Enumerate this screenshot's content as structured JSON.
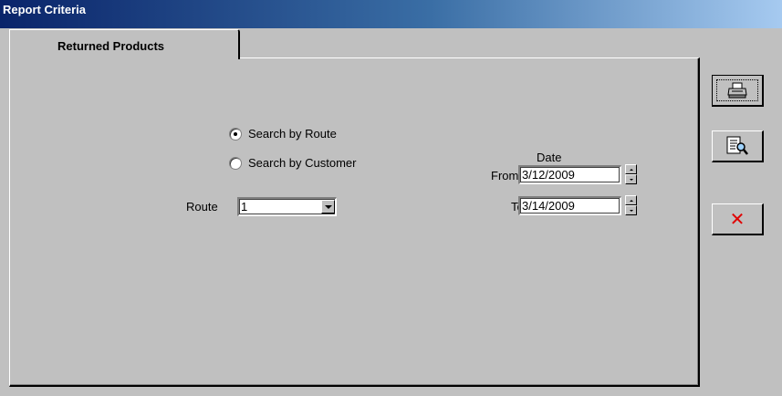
{
  "window": {
    "title": "Report Criteria"
  },
  "tabs": [
    {
      "label": "Returned Products",
      "active": true
    }
  ],
  "search_options": [
    {
      "label": "Search by Route",
      "selected": true
    },
    {
      "label": "Search by Customer",
      "selected": false
    }
  ],
  "route": {
    "label": "Route",
    "value": "1"
  },
  "date": {
    "heading": "Date",
    "from_label": "From",
    "from_value": "3/12/2009",
    "to_label": "To",
    "to_value": "3/14/2009"
  },
  "side_buttons": {
    "print_icon": "printer-icon",
    "preview_icon": "print-preview-icon",
    "close_icon": "close-icon",
    "close_color": "#e00000"
  }
}
